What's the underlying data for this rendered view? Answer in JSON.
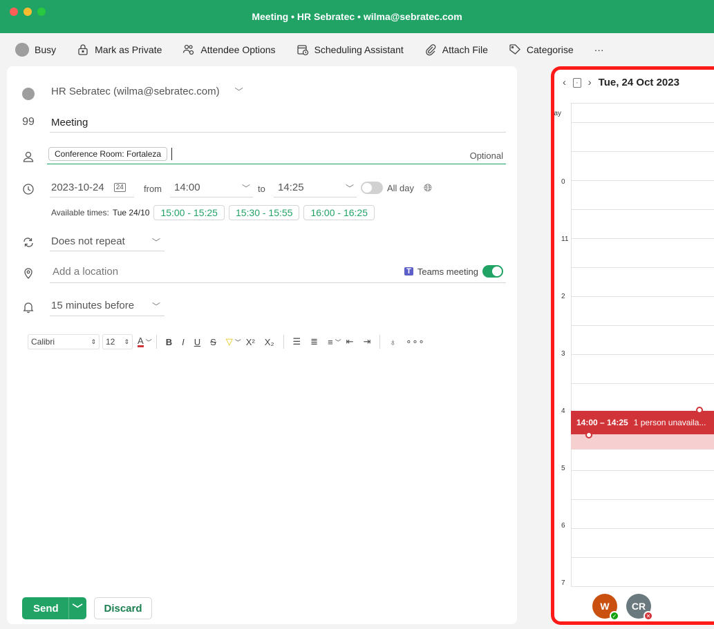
{
  "window": {
    "title": "Meeting • HR Sebratec • wilma@sebratec.com"
  },
  "toolbar": {
    "busy": "Busy",
    "mark_private": "Mark as Private",
    "attendee_options": "Attendee Options",
    "scheduling_assistant": "Scheduling Assistant",
    "attach_file": "Attach File",
    "categorise": "Categorise",
    "more": "···"
  },
  "form": {
    "account": "HR Sebratec (wilma@sebratec.com)",
    "title": "Meeting",
    "attendee_chip": "Conference Room: Fortaleza",
    "optional": "Optional",
    "date": "2023-10-24",
    "from_label": "from",
    "start_time": "14:00",
    "to_label": "to",
    "end_time": "14:25",
    "all_day": "All day",
    "available_label": "Available times:",
    "available_day": "Tue 24/10",
    "slots": [
      "15:00 - 15:25",
      "15:30 - 15:55",
      "16:00 - 16:25"
    ],
    "repeat": "Does not repeat",
    "location_placeholder": "Add a location",
    "teams": "Teams meeting",
    "reminder": "15 minutes before"
  },
  "format": {
    "font": "Calibri",
    "size": "12"
  },
  "actions": {
    "send": "Send",
    "discard": "Discard"
  },
  "calendar": {
    "date": "Tue, 24 Oct 2023",
    "all_day": "All day",
    "hours": [
      "0",
      "11",
      "2",
      "3",
      "4",
      "5",
      "6",
      "7"
    ],
    "event_time": "14:00 – 14:25",
    "event_note": "1 person unavaila...",
    "attendees": [
      {
        "initials": "W",
        "color": "#ca5010",
        "status": "accepted"
      },
      {
        "initials": "CR",
        "color": "#69797e",
        "status": "declined"
      }
    ]
  },
  "colors": {
    "accent": "#21a366",
    "event": "#d13438",
    "highlight": "#ff1a1a"
  }
}
